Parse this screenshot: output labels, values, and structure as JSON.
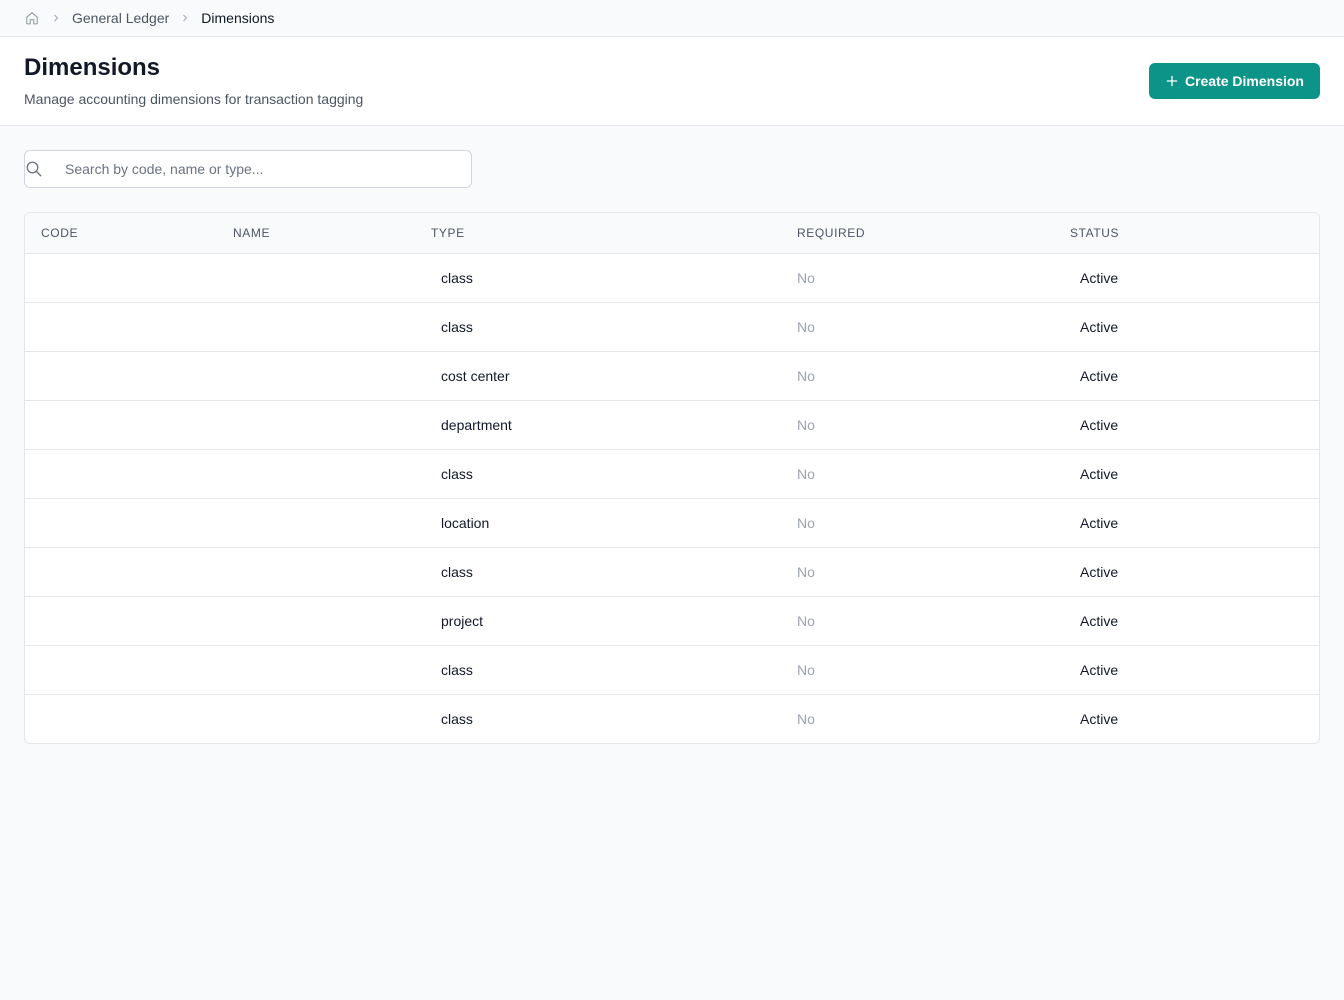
{
  "breadcrumb": {
    "home_icon": "home-icon",
    "items": [
      "General Ledger",
      "Dimensions"
    ]
  },
  "header": {
    "title": "Dimensions",
    "subtitle": "Manage accounting dimensions for transaction tagging",
    "create_button_label": "Create Dimension",
    "create_button_icon": "plus-icon"
  },
  "search": {
    "placeholder": "Search by code, name or type...",
    "value": ""
  },
  "table": {
    "columns": [
      "CODE",
      "NAME",
      "TYPE",
      "REQUIRED",
      "STATUS"
    ],
    "rows": [
      {
        "code": "",
        "name": "",
        "type": "class",
        "required": "No",
        "status": "Active"
      },
      {
        "code": "",
        "name": "",
        "type": "class",
        "required": "No",
        "status": "Active"
      },
      {
        "code": "",
        "name": "",
        "type": "cost center",
        "required": "No",
        "status": "Active"
      },
      {
        "code": "",
        "name": "",
        "type": "department",
        "required": "No",
        "status": "Active"
      },
      {
        "code": "",
        "name": "",
        "type": "class",
        "required": "No",
        "status": "Active"
      },
      {
        "code": "",
        "name": "",
        "type": "location",
        "required": "No",
        "status": "Active"
      },
      {
        "code": "",
        "name": "",
        "type": "class",
        "required": "No",
        "status": "Active"
      },
      {
        "code": "",
        "name": "",
        "type": "project",
        "required": "No",
        "status": "Active"
      },
      {
        "code": "",
        "name": "",
        "type": "class",
        "required": "No",
        "status": "Active"
      },
      {
        "code": "",
        "name": "",
        "type": "class",
        "required": "No",
        "status": "Active"
      }
    ]
  },
  "colors": {
    "accent": "#0d9488",
    "page_background": "#f9fafb",
    "muted_text": "#9ca3af"
  }
}
